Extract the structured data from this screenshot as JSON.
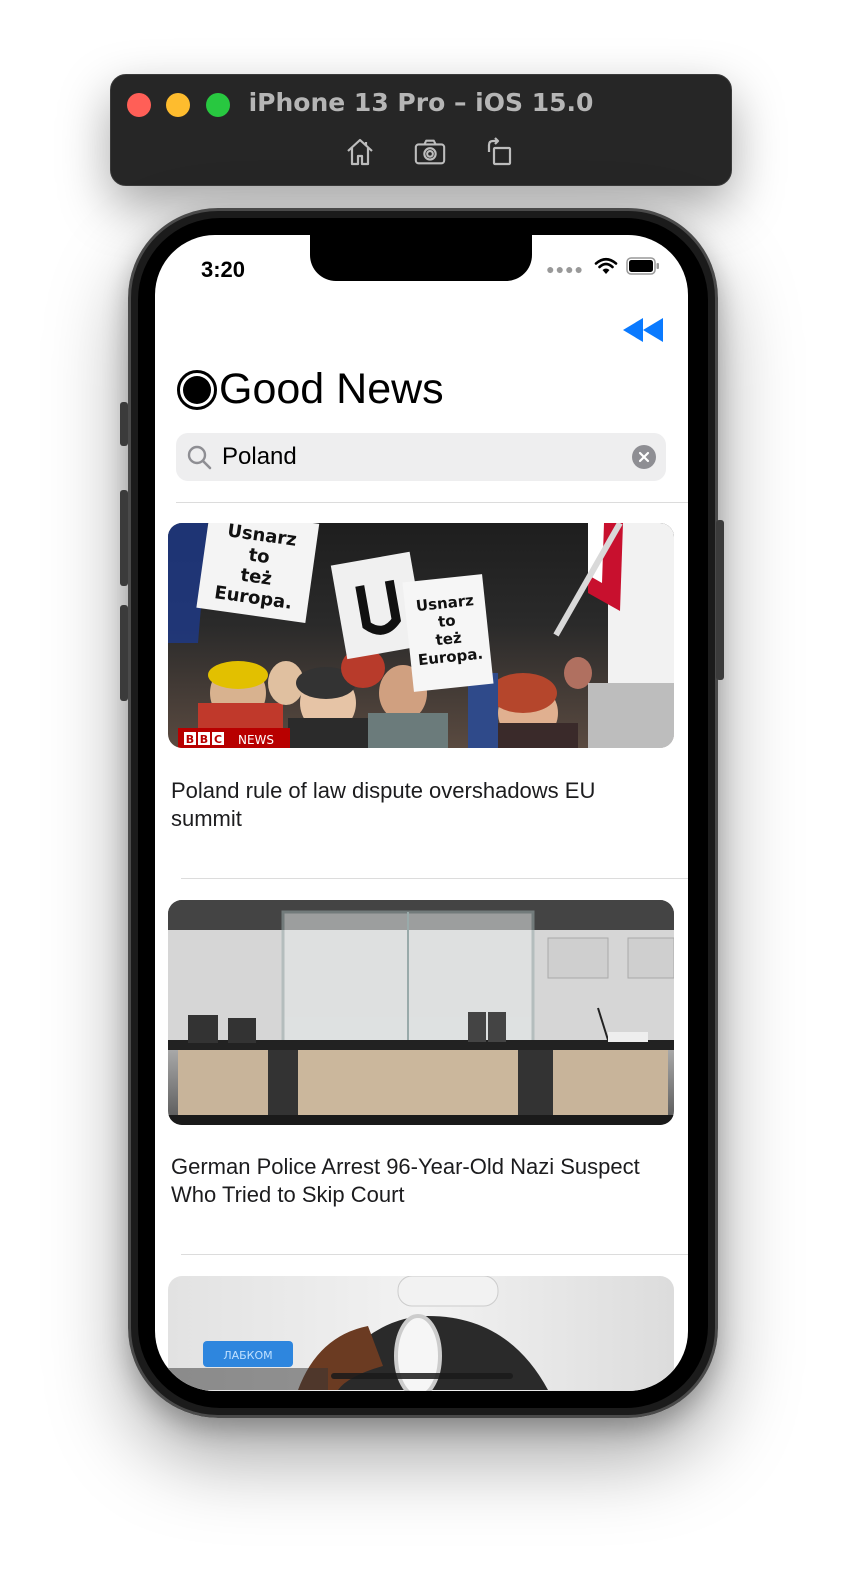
{
  "simulator": {
    "title": "iPhone 13 Pro – iOS 15.0",
    "tools": [
      "home-icon",
      "screenshot-icon",
      "rotate-icon"
    ]
  },
  "status_bar": {
    "time": "3:20",
    "icons": [
      "cellular-dots-icon",
      "wifi-icon",
      "battery-icon"
    ]
  },
  "nav": {
    "back_icon": "rewind-icon",
    "accent_color": "#0a7aff"
  },
  "header": {
    "title": "Good News",
    "title_icon": "record-circle-icon"
  },
  "search": {
    "value": "Poland",
    "icon": "search-icon",
    "clear_icon": "clear-icon"
  },
  "news": [
    {
      "title": "Poland rule of law dispute overshadows EU summit",
      "image_logo": "BBC NEWS",
      "sign_text_1": "Usnarz to też Europa.",
      "sign_text_2": "Usnarz to też Europa."
    },
    {
      "title": "German Police Arrest 96-Year-Old Nazi Suspect Who Tried to Skip Court"
    },
    {
      "title": ""
    }
  ]
}
